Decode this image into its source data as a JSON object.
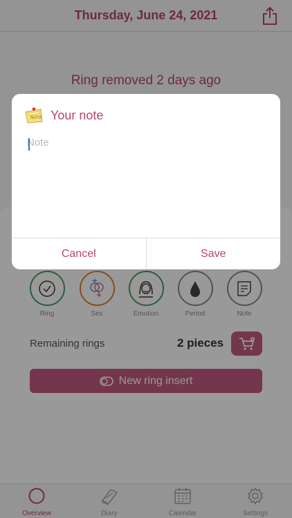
{
  "header": {
    "title": "Thursday, June 24, 2021",
    "share_icon": "share-icon"
  },
  "status": {
    "text": "Ring removed 2 days ago"
  },
  "actions": [
    {
      "label": "Ring",
      "icon": "check-circle-icon",
      "color": "#4a9a5e"
    },
    {
      "label": "Sex",
      "icon": "gender-symbols-icon",
      "color": "#d9822b"
    },
    {
      "label": "Emotion",
      "icon": "face-icon",
      "color": "#4a9a5e"
    },
    {
      "label": "Period",
      "icon": "drop-icon",
      "color": "#888888"
    },
    {
      "label": "Note",
      "icon": "note-icon",
      "color": "#888888"
    }
  ],
  "remaining": {
    "label": "Remaining rings",
    "count": "2 pieces"
  },
  "insert_button": {
    "label": "New ring insert"
  },
  "tabs": [
    {
      "label": "Overview",
      "icon": "ring-circle-icon",
      "active": true
    },
    {
      "label": "Diary",
      "icon": "book-icon",
      "active": false
    },
    {
      "label": "Calendar",
      "icon": "calendar-icon",
      "active": false
    },
    {
      "label": "Settings",
      "icon": "gear-icon",
      "active": false
    }
  ],
  "dialog": {
    "title": "Your note",
    "note_icon_text": "NOTE",
    "input": {
      "value": "",
      "placeholder": "Note"
    },
    "cancel_label": "Cancel",
    "save_label": "Save"
  },
  "colors": {
    "accent": "#b7456f",
    "button": "#c15a80",
    "green": "#4a9a5e",
    "orange": "#d9822b"
  }
}
